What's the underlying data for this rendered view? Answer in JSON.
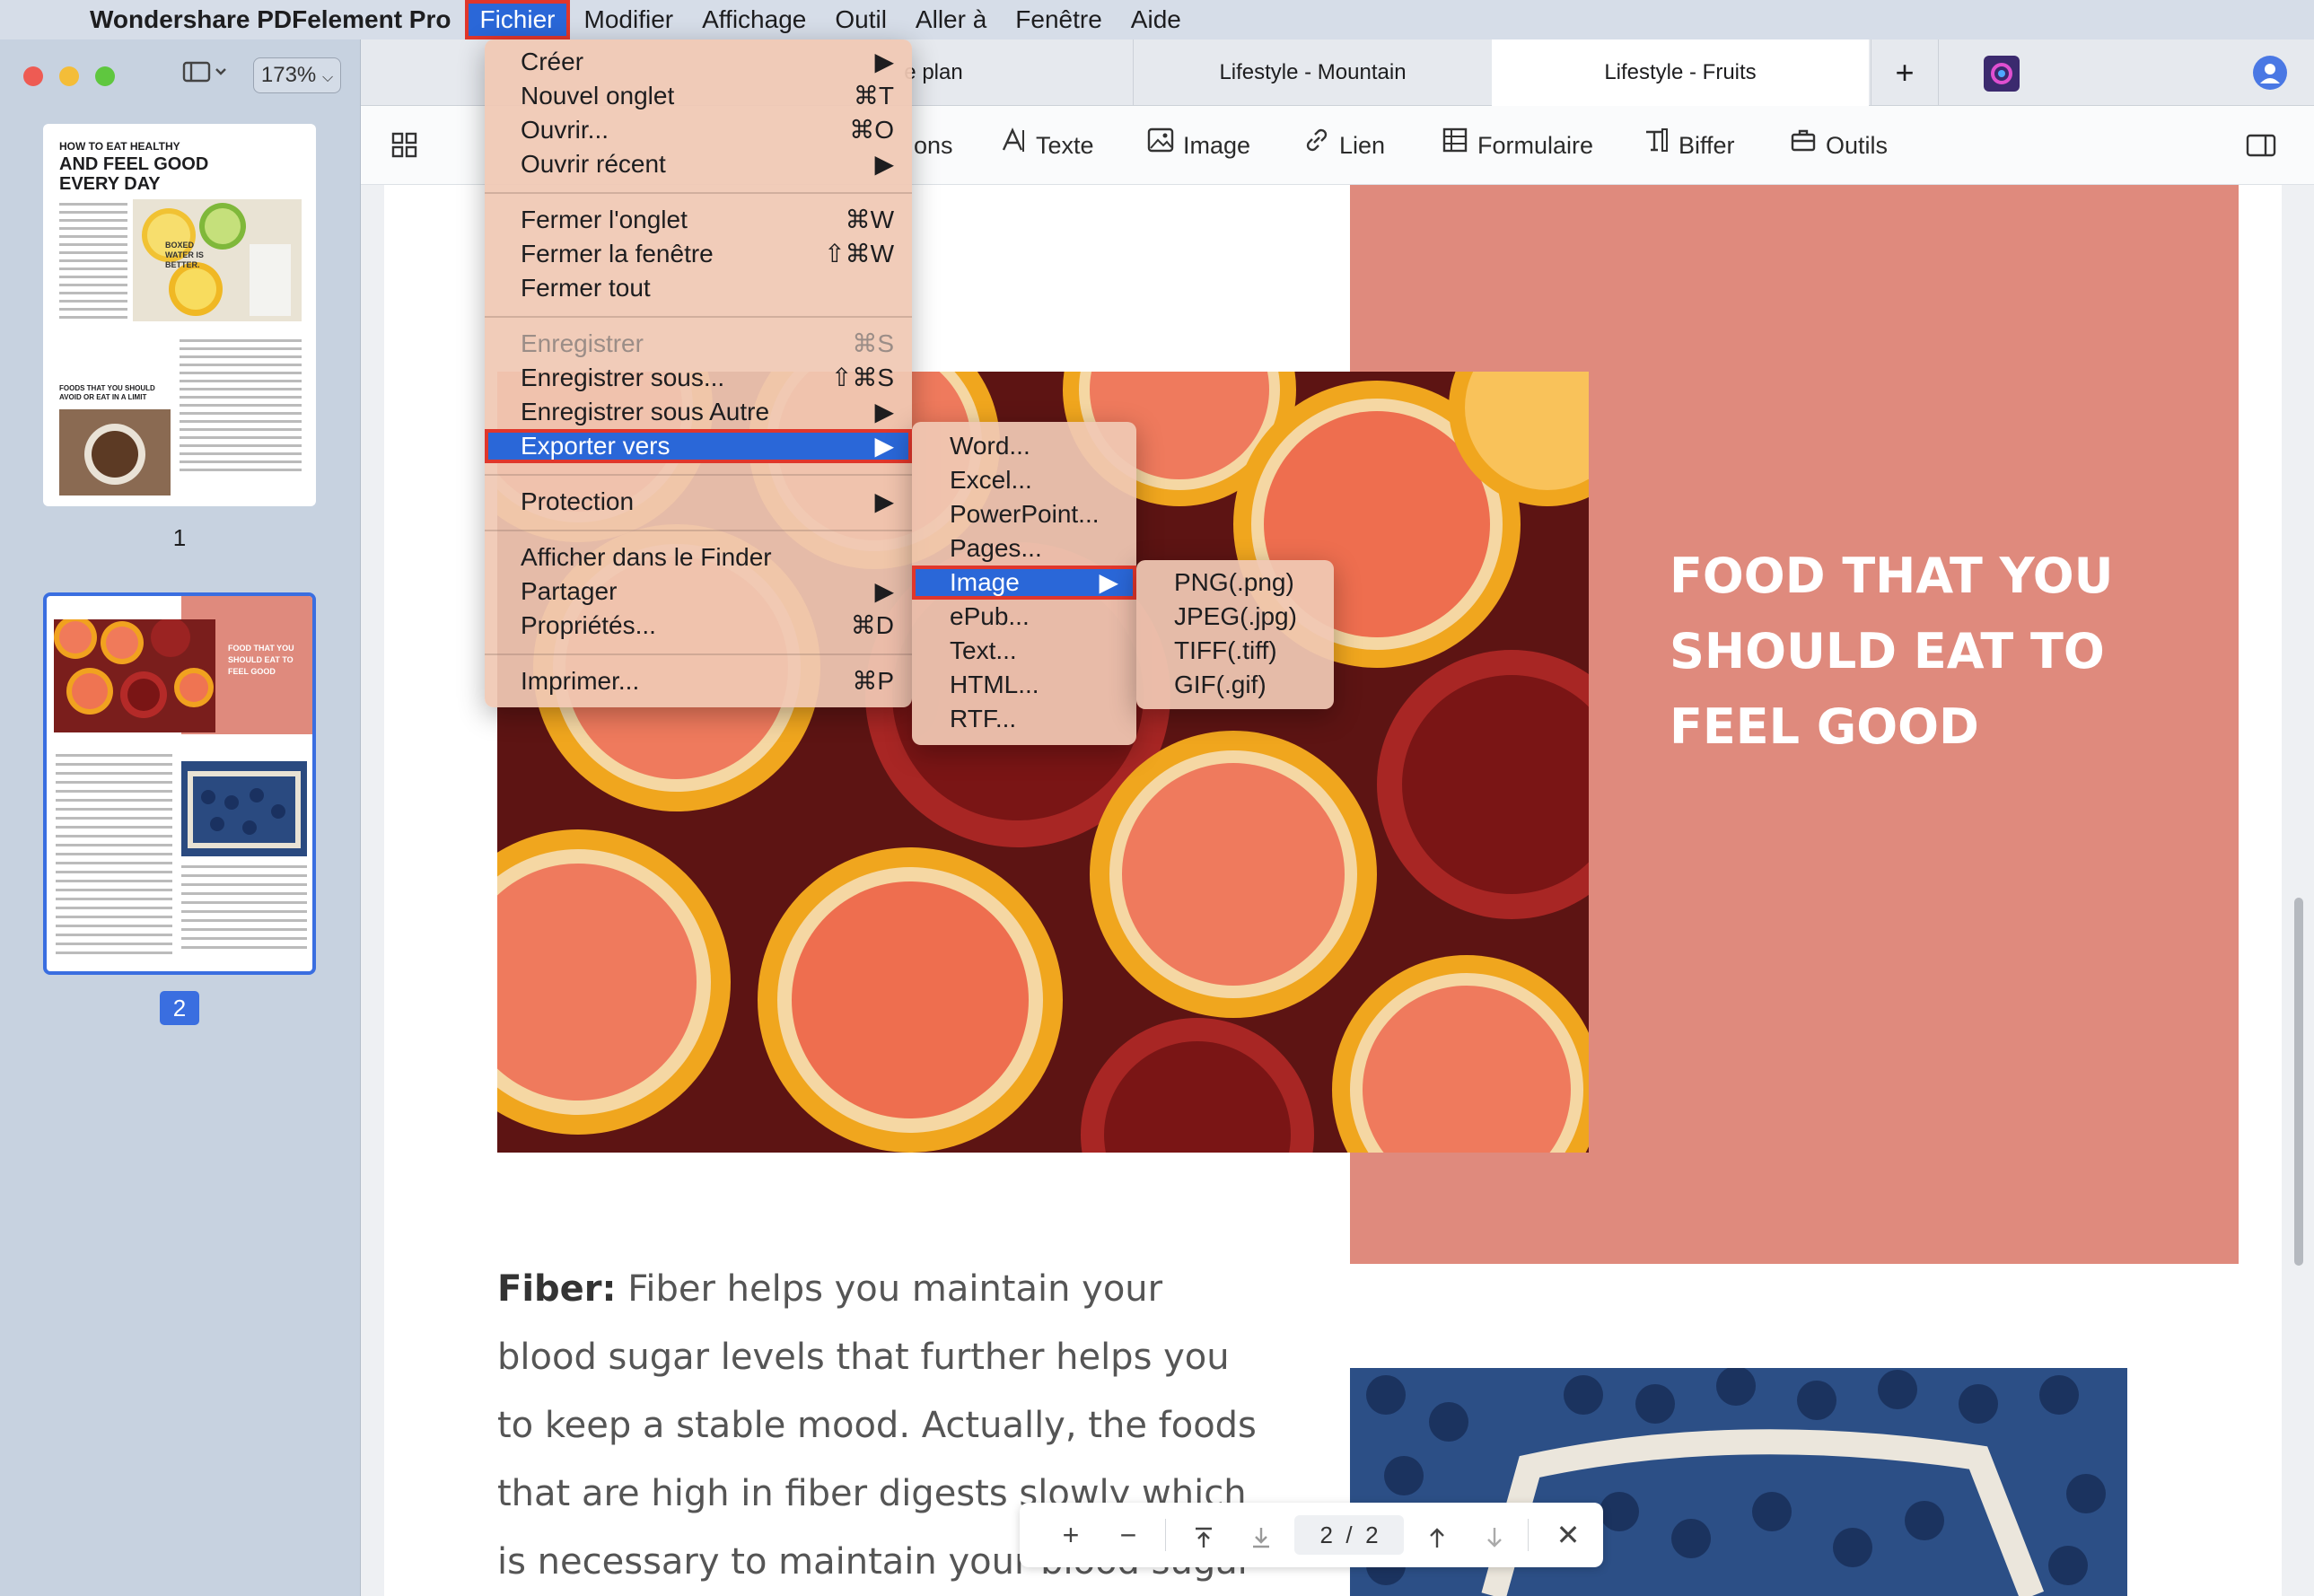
{
  "menubar": {
    "app_name": "Wondershare PDFelement Pro",
    "items": [
      "Fichier",
      "Modifier",
      "Affichage",
      "Outil",
      "Aller à",
      "Fenêtre",
      "Aide"
    ]
  },
  "sidebar": {
    "zoom": "173%",
    "page1_label": "1",
    "page2_label": "2",
    "thumb1_title_small": "HOW TO EAT HEALTHY",
    "thumb1_title_big": "AND FEEL GOOD EVERY DAY",
    "thumb1_subhead": "FOODS THAT YOU SHOULD AVOID OR EAT IN A LIMIT",
    "thumb1_boxed": "BOXED WATER IS BETTER.",
    "thumb2_pink_title": "FOOD THAT YOU SHOULD EAT TO FEEL GOOD"
  },
  "tabs": [
    {
      "label": "e plan"
    },
    {
      "label": "Lifestyle - Mountain"
    },
    {
      "label": "Lifestyle - Fruits"
    }
  ],
  "toolbar": {
    "partial": "ons",
    "texte": "Texte",
    "image": "Image",
    "lien": "Lien",
    "formulaire": "Formulaire",
    "biffer": "Biffer",
    "outils": "Outils"
  },
  "document": {
    "pink_title": "FOOD THAT YOU SHOULD EAT TO FEEL GOOD",
    "body_bold": "Fiber:",
    "body_text": " Fiber helps you maintain your blood sugar levels that further helps you to keep a stable mood. Actually, the foods that are high in fiber digests slowly which is necessary to maintain your blood sugar"
  },
  "navbar": {
    "page_current": "2",
    "page_sep": "/",
    "page_total": "2"
  },
  "fichier_menu": {
    "items": [
      {
        "label": "Créer",
        "shortcut": "▶"
      },
      {
        "label": "Nouvel onglet",
        "shortcut": "⌘T"
      },
      {
        "label": "Ouvrir...",
        "shortcut": "⌘O"
      },
      {
        "label": "Ouvrir récent",
        "shortcut": "▶"
      },
      {
        "label": "Fermer l'onglet",
        "shortcut": "⌘W"
      },
      {
        "label": "Fermer la fenêtre",
        "shortcut": "⇧⌘W"
      },
      {
        "label": "Fermer tout",
        "shortcut": ""
      },
      {
        "label": "Enregistrer",
        "shortcut": "⌘S"
      },
      {
        "label": "Enregistrer sous...",
        "shortcut": "⇧⌘S"
      },
      {
        "label": "Enregistrer sous Autre",
        "shortcut": "▶"
      },
      {
        "label": "Exporter vers",
        "shortcut": "▶"
      },
      {
        "label": "Protection",
        "shortcut": "▶"
      },
      {
        "label": "Afficher dans le Finder",
        "shortcut": ""
      },
      {
        "label": "Partager",
        "shortcut": "▶"
      },
      {
        "label": "Propriétés...",
        "shortcut": "⌘D"
      },
      {
        "label": "Imprimer...",
        "shortcut": "⌘P"
      }
    ]
  },
  "export_menu": {
    "items": [
      {
        "label": "Word...",
        "shortcut": ""
      },
      {
        "label": "Excel...",
        "shortcut": ""
      },
      {
        "label": "PowerPoint...",
        "shortcut": ""
      },
      {
        "label": "Pages...",
        "shortcut": ""
      },
      {
        "label": "Image",
        "shortcut": "▶"
      },
      {
        "label": "ePub...",
        "shortcut": ""
      },
      {
        "label": "Text...",
        "shortcut": ""
      },
      {
        "label": "HTML...",
        "shortcut": ""
      },
      {
        "label": "RTF...",
        "shortcut": ""
      }
    ]
  },
  "image_menu": {
    "items": [
      {
        "label": "PNG(.png)"
      },
      {
        "label": "JPEG(.jpg)"
      },
      {
        "label": "TIFF(.tiff)"
      },
      {
        "label": "GIF(.gif)"
      }
    ]
  },
  "colors": {
    "accent": "#2a67d8",
    "highlight_border": "#e0362b",
    "pink_block": "#df8a7d"
  }
}
